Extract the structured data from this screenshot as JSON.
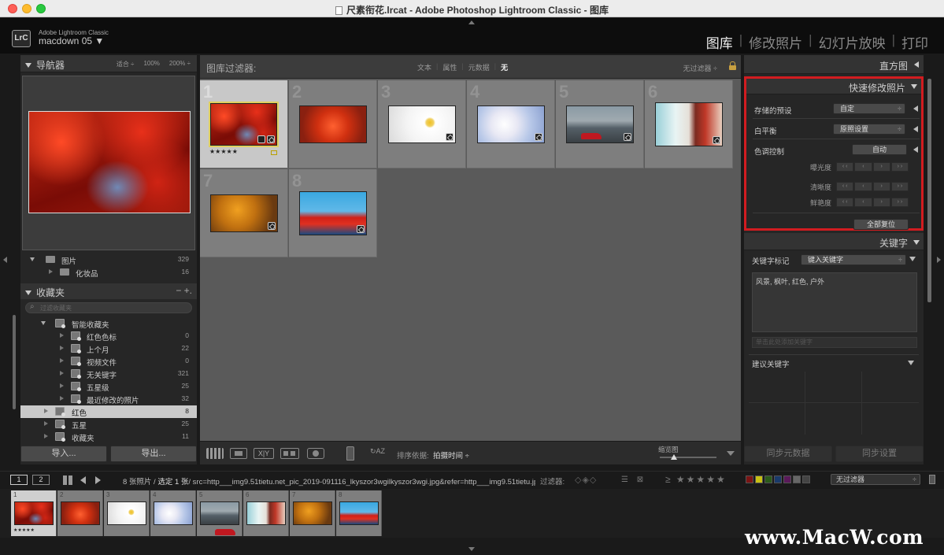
{
  "window": {
    "title": "尺素衔花.lrcat - Adobe Photoshop Lightroom Classic - 图库"
  },
  "identity": {
    "badge": "LrC",
    "app_name": "Adobe Lightroom Classic",
    "catalog": "macdown 05 ▼"
  },
  "modules": [
    {
      "label": "图库",
      "active": true
    },
    {
      "label": "修改照片",
      "active": false
    },
    {
      "label": "幻灯片放映",
      "active": false
    },
    {
      "label": "打印",
      "active": false
    }
  ],
  "navigator": {
    "title": "导航器",
    "options": [
      "适合 ÷",
      "100%",
      "200% ÷"
    ]
  },
  "folders": [
    {
      "label": "图片",
      "count": "329"
    },
    {
      "label": "化妆品",
      "count": "16"
    }
  ],
  "collections": {
    "title": "收藏夹",
    "tools": "−  +.",
    "search_placeholder": "过滤收藏夹",
    "items": [
      {
        "label": "智能收藏夹",
        "count": ""
      },
      {
        "label": "红色色标",
        "count": "0"
      },
      {
        "label": "上个月",
        "count": "22"
      },
      {
        "label": "视频文件",
        "count": "0"
      },
      {
        "label": "无关键字",
        "count": "321"
      },
      {
        "label": "五星级",
        "count": "25"
      },
      {
        "label": "最近修改的照片",
        "count": "32"
      },
      {
        "label": "红色",
        "count": "8"
      },
      {
        "label": "五星",
        "count": "25"
      },
      {
        "label": "收藏夹",
        "count": "11"
      }
    ]
  },
  "left_buttons": {
    "import": "导入...",
    "export": "导出..."
  },
  "library_filter": {
    "label": "图库过滤器:",
    "tabs": [
      {
        "label": "文本",
        "on": false
      },
      {
        "label": "属性",
        "on": false
      },
      {
        "label": "元数据",
        "on": false
      },
      {
        "label": "无",
        "on": true
      }
    ],
    "preset": "无过滤器 ÷"
  },
  "grid": {
    "cells": [
      {
        "index": "1",
        "photo": "maple",
        "selected": true,
        "stars": "★★★★★"
      },
      {
        "index": "2",
        "photo": "red2",
        "selected": false,
        "stars": ""
      },
      {
        "index": "3",
        "photo": "daisy",
        "selected": false,
        "stars": ""
      },
      {
        "index": "4",
        "photo": "blossom",
        "selected": false,
        "stars": ""
      },
      {
        "index": "5",
        "photo": "car",
        "selected": false,
        "stars": ""
      },
      {
        "index": "6",
        "photo": "girl",
        "selected": false,
        "stars": ""
      },
      {
        "index": "7",
        "photo": "autumn",
        "selected": false,
        "stars": ""
      },
      {
        "index": "8",
        "photo": "seaside",
        "selected": false,
        "stars": ""
      }
    ]
  },
  "toolbar": {
    "xy_label": "X|Y",
    "sort_icon": "↻AZ",
    "sort_label": "排序依据:",
    "sort_value": "拍摄时间 ÷",
    "thumb_label": "缩览图"
  },
  "right_panel": {
    "histogram": "直方图",
    "quick_develop": {
      "title": "快速修改照片",
      "saved_preset_label": "存储的预设",
      "saved_preset_value": "自定",
      "wb_label": "白平衡",
      "wb_value": "原照设置",
      "tone_label": "色调控制",
      "auto_button": "自动",
      "exposure": "曝光度",
      "clarity": "清晰度",
      "vibrance": "鲜艳度",
      "step_labels": [
        "‹ ‹",
        "‹",
        "›",
        "› ›"
      ],
      "reset_all": "全部复位"
    },
    "keywording": {
      "title": "关键字",
      "tags_label": "关键字标记",
      "tags_value": "键入关键字",
      "keywords": "风景, 枫叶, 红色, 户外",
      "input_placeholder": "单击此处添加关键字",
      "suggestions": "建议关键字"
    },
    "sync_metadata": "同步元数据",
    "sync_settings": "同步设置"
  },
  "filmstrip_bar": {
    "screen1": "1",
    "screen2": "2",
    "info_prefix": "8 张照片 / ",
    "info_selected": "选定 1 张",
    "info_path": "/ src=http___img9.51tietu.net_pic_2019-091116_lkyszor3wgilkyszor3wgi.jpg&refer=http___img9.51tietu.jp",
    "filter_label": "过滤器:",
    "flag_icons": "◇◈◇",
    "color_icons": "☰ ⊠",
    "stars": "≥ ★★★★★",
    "no_filter": "无过滤器",
    "swatch_colors": [
      "#7a1414",
      "#c8c014",
      "#2a5a1a",
      "#1a3a6a",
      "#5a1a5a",
      "#666666",
      "#444444"
    ]
  },
  "filmstrip": {
    "cells": [
      {
        "index": "1",
        "photo": "maple",
        "selected": true,
        "stars": "★★★★★"
      },
      {
        "index": "2",
        "photo": "red2",
        "selected": false,
        "stars": ""
      },
      {
        "index": "3",
        "photo": "daisy",
        "selected": false,
        "stars": ""
      },
      {
        "index": "4",
        "photo": "blossom",
        "selected": false,
        "stars": ""
      },
      {
        "index": "5",
        "photo": "car",
        "selected": false,
        "stars": ""
      },
      {
        "index": "6",
        "photo": "girl",
        "selected": false,
        "stars": ""
      },
      {
        "index": "7",
        "photo": "autumn",
        "selected": false,
        "stars": ""
      },
      {
        "index": "8",
        "photo": "seaside",
        "selected": false,
        "stars": ""
      }
    ]
  },
  "watermark": "www.MacW.com"
}
